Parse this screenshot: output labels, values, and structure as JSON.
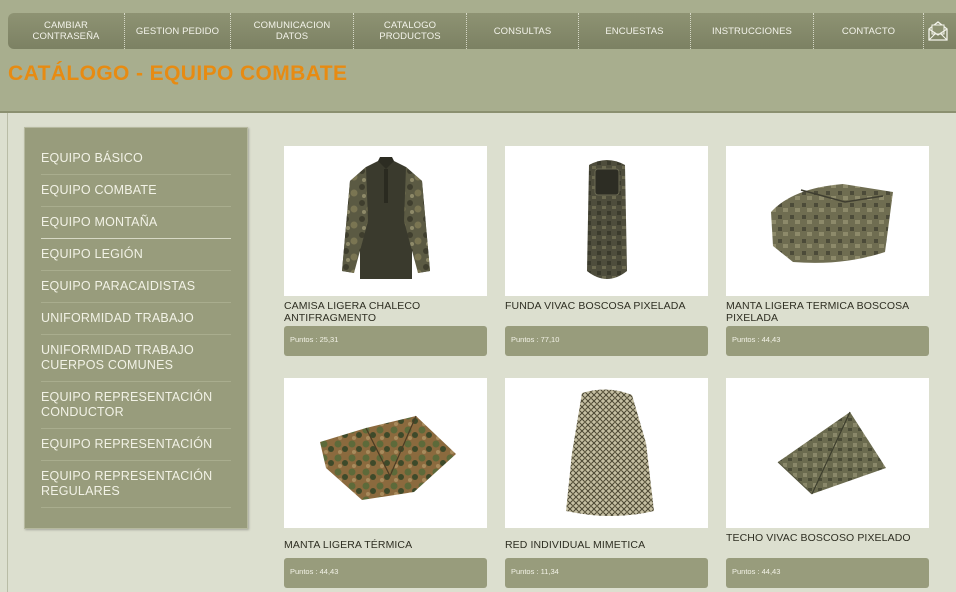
{
  "nav": {
    "items": [
      {
        "label": "CAMBIAR CONTRASEÑA",
        "lines": [
          "CAMBIAR",
          "CONTRASEÑA"
        ]
      },
      {
        "label": "GESTION PEDIDO",
        "lines": [
          "GESTION PEDIDO"
        ]
      },
      {
        "label": "COMUNICACION DATOS",
        "lines": [
          "COMUNICACION",
          "DATOS"
        ]
      },
      {
        "label": "CATALOGO PRODUCTOS",
        "lines": [
          "CATALOGO",
          "PRODUCTOS"
        ]
      },
      {
        "label": "CONSULTAS",
        "lines": [
          "CONSULTAS"
        ]
      },
      {
        "label": "ENCUESTAS",
        "lines": [
          "ENCUESTAS"
        ]
      },
      {
        "label": "INSTRUCCIONES",
        "lines": [
          "INSTRUCCIONES"
        ]
      },
      {
        "label": "CONTACTO",
        "lines": [
          "CONTACTO"
        ]
      }
    ],
    "mail_icon": "envelope-icon"
  },
  "page": {
    "title": "CATÁLOGO - EQUIPO COMBATE"
  },
  "sidebar": {
    "items": [
      {
        "label": "EQUIPO BÁSICO"
      },
      {
        "label": "EQUIPO COMBATE"
      },
      {
        "label": "EQUIPO MONTAÑA"
      },
      {
        "label": "EQUIPO LEGIÓN"
      },
      {
        "label": "EQUIPO PARACAIDISTAS"
      },
      {
        "label": "UNIFORMIDAD TRABAJO"
      },
      {
        "label": "UNIFORMIDAD TRABAJO CUERPOS COMUNES"
      },
      {
        "label": "EQUIPO REPRESENTACIÓN CONDUCTOR"
      },
      {
        "label": "EQUIPO REPRESENTACIÓN"
      },
      {
        "label": "EQUIPO REPRESENTACIÓN REGULARES"
      }
    ]
  },
  "products": [
    {
      "name": "CAMISA LIGERA CHALECO ANTIFRAGMENTO",
      "points": "Puntos : 25,31",
      "icon": "shirt-icon"
    },
    {
      "name": "FUNDA VIVAC BOSCOSA PIXELADA",
      "points": "Puntos : 77,10",
      "icon": "bivy-bag-icon"
    },
    {
      "name": "MANTA LIGERA TERMICA BOSCOSA PIXELADA",
      "points": "Puntos : 44,43",
      "icon": "blanket-icon"
    },
    {
      "name": "MANTA LIGERA TÉRMICA",
      "points": "Puntos : 44,43",
      "icon": "folded-blanket-icon"
    },
    {
      "name": "RED INDIVIDUAL MIMETICA",
      "points": "Puntos : 11,34",
      "icon": "camo-net-icon"
    },
    {
      "name": "TECHO VIVAC BOSCOSO PIXELADO",
      "points": "Puntos : 44,43",
      "icon": "tarp-shelter-icon"
    }
  ],
  "colors": {
    "accent_title": "#e78b12",
    "nav_bg": "#8e9373",
    "panel": "#989c7c",
    "page_bg": "#dcdfcf"
  }
}
